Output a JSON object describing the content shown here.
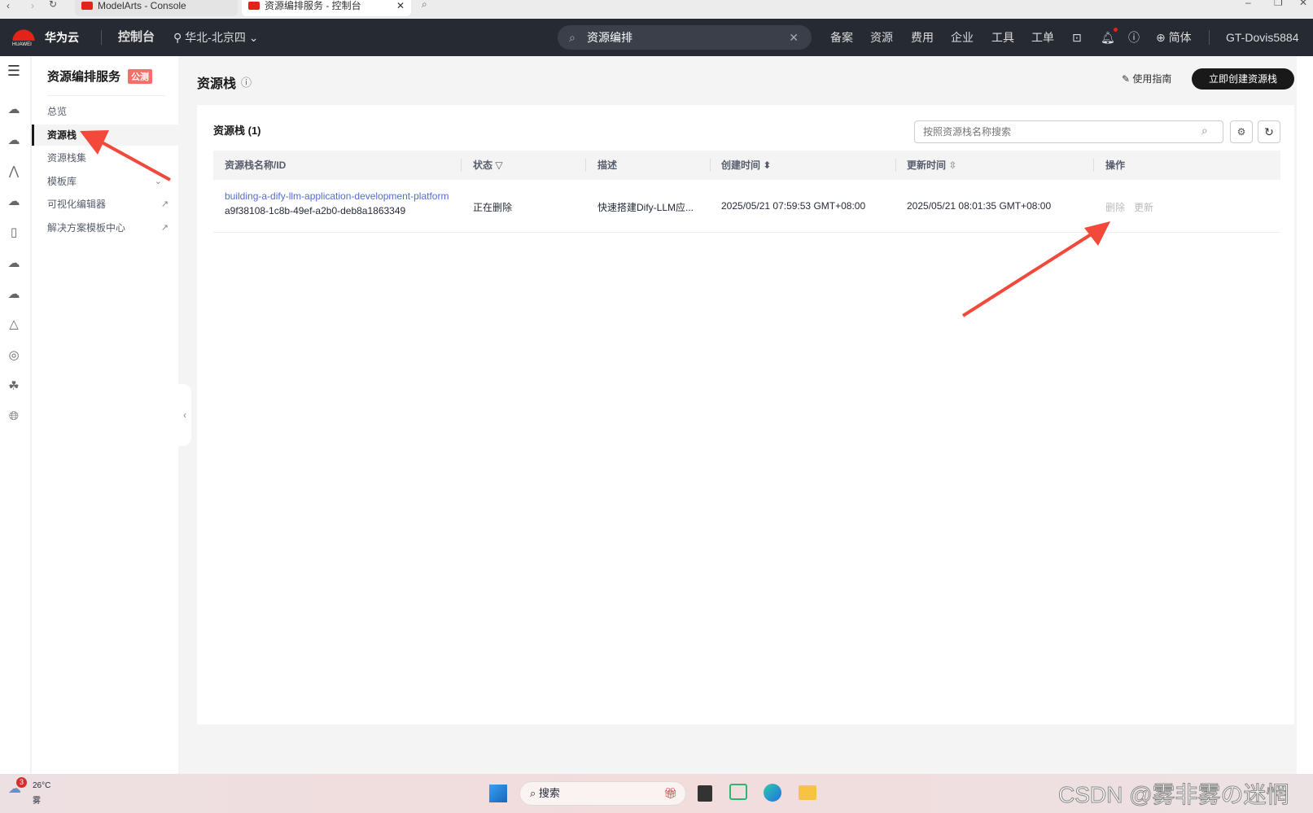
{
  "browser": {
    "tabs": [
      {
        "title": "ModelArts - Console"
      },
      {
        "title": "资源编排服务 - 控制台"
      }
    ]
  },
  "header": {
    "brand": "华为云",
    "logo_text": "HUAWEI",
    "console": "控制台",
    "region": "华北-北京四",
    "search_value": "资源编排",
    "nav": [
      "备案",
      "资源",
      "费用",
      "企业",
      "工具",
      "工单"
    ],
    "language": "简体",
    "user": "GT-Dovis5884",
    "notification_dot_color": "#e2231a"
  },
  "sidebar": {
    "title": "资源编排服务",
    "badge": "公测",
    "items": [
      {
        "label": "总览"
      },
      {
        "label": "资源栈",
        "active": true
      },
      {
        "label": "资源栈集"
      },
      {
        "label": "模板库",
        "expandable": true
      },
      {
        "label": "可视化编辑器",
        "external": true
      },
      {
        "label": "解决方案模板中心",
        "external": true
      }
    ]
  },
  "page": {
    "title": "资源栈",
    "guide": "使用指南",
    "create_button": "立即创建资源栈"
  },
  "card": {
    "title": "资源栈 (1)",
    "search_placeholder": "按照资源栈名称搜索",
    "columns": [
      "资源栈名称/ID",
      "状态",
      "描述",
      "创建时间",
      "更新时间",
      "操作"
    ],
    "rows": [
      {
        "name": "building-a-dify-llm-application-development-platform",
        "id": "a9f38108-1c8b-49ef-a2b0-deb8a1863349",
        "status": "正在删除",
        "description": "快速搭建Dify-LLM应...",
        "created": "2025/05/21 07:59:53 GMT+08:00",
        "updated": "2025/05/21 08:01:35 GMT+08:00",
        "actions": [
          "删除",
          "更新"
        ]
      }
    ]
  },
  "taskbar": {
    "weather_temp": "26°C",
    "weather_desc": "雾",
    "weather_badge": "3",
    "search": "搜索",
    "watermark": "CSDN @雾非雾の迷惘"
  },
  "colors": {
    "link": "#526ecc",
    "header_bg": "#262a33",
    "badge": "#f66f6a",
    "annotation_arrow": "#f2493a"
  }
}
